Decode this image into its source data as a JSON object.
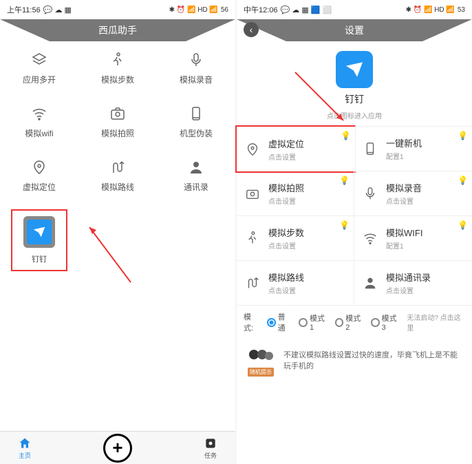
{
  "left": {
    "status": {
      "time": "上午11:56",
      "battery": "56"
    },
    "title": "西瓜助手",
    "grid": [
      {
        "label": "应用多开"
      },
      {
        "label": "模拟步数"
      },
      {
        "label": "模拟录音"
      },
      {
        "label": "模拟wifi"
      },
      {
        "label": "模拟拍照"
      },
      {
        "label": "机型伪装"
      },
      {
        "label": "虚拟定位"
      },
      {
        "label": "模拟路线"
      },
      {
        "label": "通讯录"
      }
    ],
    "app": {
      "label": "钉钉"
    },
    "nav": {
      "home": "主页",
      "task": "任务"
    }
  },
  "right": {
    "status": {
      "time": "中午12:06",
      "battery": "53"
    },
    "title": "设置",
    "app": {
      "name": "钉钉",
      "sub": "点击图标进入应用"
    },
    "settings": [
      {
        "title": "虚拟定位",
        "sub": "点击设置"
      },
      {
        "title": "一键新机",
        "sub": "配置1"
      },
      {
        "title": "模拟拍照",
        "sub": "点击设置"
      },
      {
        "title": "模拟录音",
        "sub": "点击设置"
      },
      {
        "title": "模拟步数",
        "sub": "点击设置"
      },
      {
        "title": "模拟WIFI",
        "sub": "配置1"
      },
      {
        "title": "模拟路线",
        "sub": "点击设置"
      },
      {
        "title": "模拟通讯录",
        "sub": "点击设置"
      }
    ],
    "modes": {
      "label": "模式:",
      "options": [
        "普通",
        "模式1",
        "模式2",
        "模式3"
      ],
      "help": "无法启动? 点击这里"
    },
    "tip": {
      "label": "随机提示",
      "text": "不建议模拟路线设置过快的速度，毕竟飞机上是不能玩手机的"
    }
  }
}
